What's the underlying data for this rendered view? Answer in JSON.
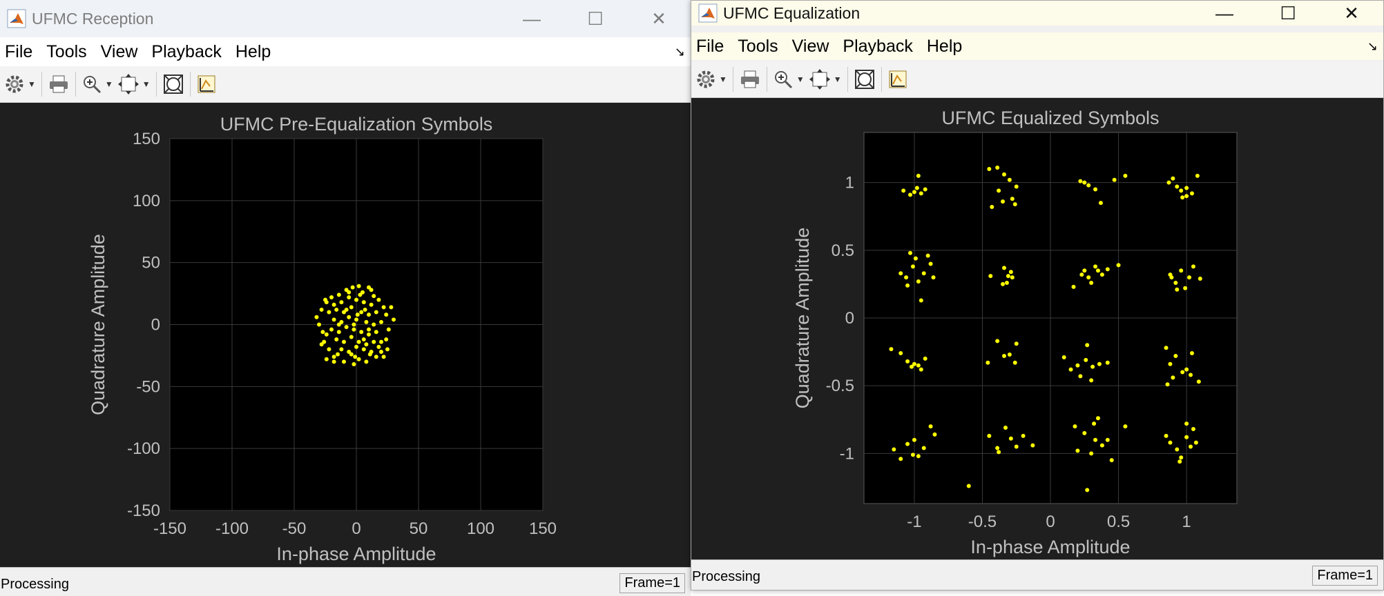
{
  "left_window": {
    "title": "UFMC Reception",
    "menu": [
      "File",
      "Tools",
      "View",
      "Playback",
      "Help"
    ],
    "status": "Processing",
    "frame": "Frame=1"
  },
  "right_window": {
    "title": "UFMC Equalization",
    "menu": [
      "File",
      "Tools",
      "View",
      "Playback",
      "Help"
    ],
    "status": "Processing",
    "frame": "Frame=1"
  },
  "toolbar_icons": [
    "gear-icon",
    "print-icon",
    "zoom-in-icon",
    "fit-axes-icon",
    "autoscale-icon",
    "highlight-icon"
  ],
  "window_controls": {
    "minimize": "—",
    "maximize": "☐",
    "close": "✕"
  },
  "colors": {
    "plot_bg": "#000000",
    "figure_bg": "#1f1f1f",
    "points": "#ffff00",
    "grid": "#3a3a3a",
    "text": "#c0c0c0"
  },
  "chart_data": [
    {
      "type": "scatter",
      "title": "UFMC Pre-Equalization Symbols",
      "xlabel": "In-phase Amplitude",
      "ylabel": "Quadrature Amplitude",
      "xlim": [
        -150,
        150
      ],
      "ylim": [
        -150,
        150
      ],
      "xticks": [
        -150,
        -100,
        -50,
        0,
        50,
        100,
        150
      ],
      "yticks": [
        150,
        100,
        50,
        0,
        -50,
        -100,
        -150
      ],
      "xtick_labels": [
        "-150",
        "-100",
        "-50",
        "0",
        "50",
        "100",
        "150"
      ],
      "ytick_labels": [
        "150",
        "100",
        "50",
        "0",
        "-50",
        "-100",
        "-150"
      ],
      "grid": true,
      "points": [
        [
          -3,
          30
        ],
        [
          2,
          31
        ],
        [
          -8,
          28
        ],
        [
          10,
          30
        ],
        [
          -14,
          24
        ],
        [
          5,
          26
        ],
        [
          -20,
          22
        ],
        [
          14,
          23
        ],
        [
          -24,
          18
        ],
        [
          18,
          20
        ],
        [
          -28,
          12
        ],
        [
          22,
          14
        ],
        [
          -32,
          6
        ],
        [
          24,
          8
        ],
        [
          -30,
          0
        ],
        [
          30,
          4
        ],
        [
          -27,
          -6
        ],
        [
          26,
          -4
        ],
        [
          -26,
          -14
        ],
        [
          24,
          -12
        ],
        [
          -22,
          -20
        ],
        [
          20,
          -22
        ],
        [
          -18,
          -26
        ],
        [
          16,
          -26
        ],
        [
          -10,
          -30
        ],
        [
          8,
          -30
        ],
        [
          -2,
          -32
        ],
        [
          2,
          -28
        ],
        [
          -24,
          -28
        ],
        [
          22,
          -26
        ],
        [
          -12,
          18
        ],
        [
          -6,
          22
        ],
        [
          0,
          20
        ],
        [
          6,
          18
        ],
        [
          12,
          16
        ],
        [
          -16,
          12
        ],
        [
          -10,
          10
        ],
        [
          -4,
          14
        ],
        [
          4,
          10
        ],
        [
          10,
          8
        ],
        [
          16,
          10
        ],
        [
          -18,
          4
        ],
        [
          -12,
          2
        ],
        [
          -6,
          6
        ],
        [
          0,
          4
        ],
        [
          8,
          2
        ],
        [
          14,
          0
        ],
        [
          -20,
          -4
        ],
        [
          -14,
          -6
        ],
        [
          -8,
          -2
        ],
        [
          -2,
          -4
        ],
        [
          4,
          -6
        ],
        [
          10,
          -8
        ],
        [
          16,
          -6
        ],
        [
          -16,
          -12
        ],
        [
          -10,
          -14
        ],
        [
          -4,
          -10
        ],
        [
          2,
          -14
        ],
        [
          8,
          -16
        ],
        [
          14,
          -14
        ],
        [
          -12,
          -20
        ],
        [
          -6,
          -22
        ],
        [
          0,
          -18
        ],
        [
          6,
          -20
        ],
        [
          12,
          -22
        ],
        [
          -18,
          16
        ],
        [
          -22,
          10
        ],
        [
          20,
          2
        ],
        [
          -24,
          -8
        ],
        [
          18,
          -18
        ],
        [
          -6,
          26
        ],
        [
          3,
          24
        ],
        [
          -15,
          -24
        ],
        [
          -1,
          -26
        ],
        [
          11,
          -24
        ],
        [
          20,
          -14
        ],
        [
          -8,
          12
        ],
        [
          6,
          -12
        ],
        [
          -2,
          0
        ],
        [
          1,
          8
        ],
        [
          -25,
          20
        ],
        [
          25,
          -20
        ],
        [
          -28,
          -16
        ],
        [
          28,
          14
        ],
        [
          -18,
          -30
        ],
        [
          12,
          28
        ],
        [
          -4,
          -24
        ],
        [
          10,
          -4
        ],
        [
          -14,
          0
        ],
        [
          7,
          12
        ]
      ]
    },
    {
      "type": "scatter",
      "title": "UFMC Equalized Symbols",
      "xlabel": "In-phase Amplitude",
      "ylabel": "Quadrature Amplitude",
      "xlim": [
        -1.37,
        1.37
      ],
      "ylim": [
        -1.37,
        1.37
      ],
      "xticks": [
        -1,
        -0.5,
        0,
        0.5,
        1
      ],
      "yticks": [
        1,
        0.5,
        0,
        -0.5,
        -1
      ],
      "xtick_labels": [
        "-1",
        "-0.5",
        "0",
        "0.5",
        "1"
      ],
      "ytick_labels": [
        "1",
        "0.5",
        "0",
        "-0.5",
        "-1"
      ],
      "grid": true,
      "points": [
        [
          -1.08,
          0.94
        ],
        [
          -1.03,
          0.91
        ],
        [
          -0.98,
          0.96
        ],
        [
          -0.95,
          0.92
        ],
        [
          -0.92,
          0.95
        ],
        [
          -0.97,
          1.05
        ],
        [
          -1.0,
          0.93
        ],
        [
          -0.45,
          1.1
        ],
        [
          -0.39,
          1.11
        ],
        [
          -0.34,
          1.06
        ],
        [
          -0.3,
          1.02
        ],
        [
          -0.25,
          0.97
        ],
        [
          -0.28,
          0.88
        ],
        [
          -0.35,
          0.86
        ],
        [
          -0.43,
          0.82
        ],
        [
          -0.38,
          0.94
        ],
        [
          -0.26,
          0.84
        ],
        [
          0.22,
          1.01
        ],
        [
          0.28,
          0.98
        ],
        [
          0.33,
          0.95
        ],
        [
          0.37,
          0.85
        ],
        [
          0.47,
          1.02
        ],
        [
          0.55,
          1.05
        ],
        [
          0.25,
          1.0
        ],
        [
          0.87,
          1.0
        ],
        [
          0.93,
          0.97
        ],
        [
          0.96,
          0.94
        ],
        [
          1.0,
          0.96
        ],
        [
          1.04,
          0.92
        ],
        [
          1.08,
          1.05
        ],
        [
          0.97,
          0.89
        ],
        [
          1.0,
          0.9
        ],
        [
          0.9,
          1.03
        ],
        [
          -1.1,
          0.33
        ],
        [
          -1.06,
          0.3
        ],
        [
          -1.01,
          0.38
        ],
        [
          -0.97,
          0.27
        ],
        [
          -0.93,
          0.33
        ],
        [
          -0.88,
          0.4
        ],
        [
          -0.86,
          0.3
        ],
        [
          -1.05,
          0.24
        ],
        [
          -0.99,
          0.44
        ],
        [
          -0.9,
          0.46
        ],
        [
          -0.95,
          0.13
        ],
        [
          -1.03,
          0.48
        ],
        [
          -0.44,
          0.31
        ],
        [
          -0.34,
          0.37
        ],
        [
          -0.31,
          0.31
        ],
        [
          -0.28,
          0.3
        ],
        [
          -0.32,
          0.26
        ],
        [
          -0.29,
          0.34
        ],
        [
          -0.35,
          0.25
        ],
        [
          0.17,
          0.23
        ],
        [
          0.23,
          0.32
        ],
        [
          0.28,
          0.3
        ],
        [
          0.3,
          0.26
        ],
        [
          0.35,
          0.35
        ],
        [
          0.38,
          0.32
        ],
        [
          0.42,
          0.36
        ],
        [
          0.5,
          0.39
        ],
        [
          0.25,
          0.35
        ],
        [
          0.33,
          0.38
        ],
        [
          0.88,
          0.32
        ],
        [
          0.92,
          0.26
        ],
        [
          0.96,
          0.35
        ],
        [
          0.99,
          0.22
        ],
        [
          1.02,
          0.3
        ],
        [
          1.05,
          0.38
        ],
        [
          1.1,
          0.29
        ],
        [
          0.93,
          0.21
        ],
        [
          0.89,
          0.3
        ],
        [
          -1.17,
          -0.23
        ],
        [
          -1.1,
          -0.26
        ],
        [
          -1.05,
          -0.32
        ],
        [
          -1.0,
          -0.34
        ],
        [
          -0.95,
          -0.38
        ],
        [
          -0.92,
          -0.3
        ],
        [
          -1.02,
          -0.36
        ],
        [
          -0.97,
          -0.35
        ],
        [
          -0.46,
          -0.33
        ],
        [
          -0.39,
          -0.17
        ],
        [
          -0.34,
          -0.28
        ],
        [
          -0.3,
          -0.27
        ],
        [
          -0.26,
          -0.33
        ],
        [
          -0.25,
          -0.19
        ],
        [
          0.1,
          -0.29
        ],
        [
          0.15,
          -0.38
        ],
        [
          0.2,
          -0.35
        ],
        [
          0.26,
          -0.31
        ],
        [
          0.31,
          -0.36
        ],
        [
          0.36,
          -0.34
        ],
        [
          0.42,
          -0.33
        ],
        [
          0.27,
          -0.2
        ],
        [
          0.3,
          -0.46
        ],
        [
          0.22,
          -0.43
        ],
        [
          0.85,
          -0.22
        ],
        [
          0.88,
          -0.34
        ],
        [
          0.92,
          -0.28
        ],
        [
          0.97,
          -0.4
        ],
        [
          1.0,
          -0.38
        ],
        [
          1.04,
          -0.26
        ],
        [
          1.09,
          -0.47
        ],
        [
          0.86,
          -0.49
        ],
        [
          1.03,
          -0.42
        ],
        [
          0.9,
          -0.44
        ],
        [
          -1.15,
          -0.97
        ],
        [
          -1.1,
          -1.04
        ],
        [
          -1.05,
          -0.93
        ],
        [
          -1.0,
          -0.9
        ],
        [
          -0.97,
          -1.02
        ],
        [
          -0.93,
          -0.96
        ],
        [
          -0.88,
          -0.8
        ],
        [
          -0.85,
          -0.86
        ],
        [
          -1.01,
          -1.01
        ],
        [
          -0.6,
          -1.24
        ],
        [
          -0.45,
          -0.87
        ],
        [
          -0.39,
          -0.96
        ],
        [
          -0.33,
          -0.81
        ],
        [
          -0.29,
          -0.89
        ],
        [
          -0.25,
          -0.95
        ],
        [
          -0.2,
          -0.87
        ],
        [
          -0.13,
          -0.94
        ],
        [
          -0.38,
          -0.99
        ],
        [
          0.18,
          -0.8
        ],
        [
          0.2,
          -0.98
        ],
        [
          0.25,
          -0.85
        ],
        [
          0.3,
          -1.0
        ],
        [
          0.33,
          -0.9
        ],
        [
          0.35,
          -0.74
        ],
        [
          0.38,
          -0.94
        ],
        [
          0.42,
          -0.9
        ],
        [
          0.45,
          -1.05
        ],
        [
          0.55,
          -0.8
        ],
        [
          0.27,
          -1.27
        ],
        [
          0.32,
          -0.78
        ],
        [
          0.85,
          -0.87
        ],
        [
          0.88,
          -0.92
        ],
        [
          0.93,
          -0.97
        ],
        [
          0.96,
          -1.03
        ],
        [
          1.0,
          -0.88
        ],
        [
          1.03,
          -0.95
        ],
        [
          1.07,
          -0.92
        ],
        [
          1.0,
          -0.78
        ],
        [
          1.05,
          -0.82
        ],
        [
          0.95,
          -1.06
        ]
      ]
    }
  ]
}
